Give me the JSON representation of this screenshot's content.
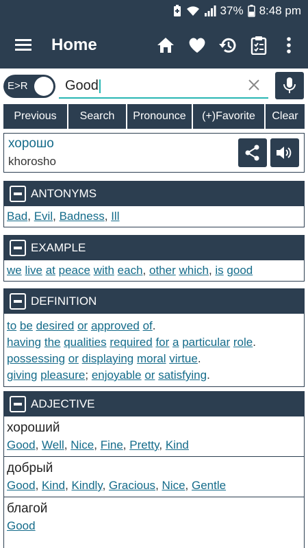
{
  "status": {
    "battery_pct": "37%",
    "time": "8:48 pm"
  },
  "appbar": {
    "title": "Home",
    "actions": [
      "home-icon",
      "heart-icon",
      "history-icon",
      "clipboard-icon",
      "more-icon"
    ]
  },
  "search": {
    "toggle_label": "E>R",
    "value": "Good"
  },
  "buttons": {
    "previous": "Previous",
    "search": "Search",
    "pronounce": "Pronounce",
    "favorite": "(+)Favorite",
    "clear": "Clear"
  },
  "result": {
    "word": "хорошо",
    "transliteration": "khorosho"
  },
  "antonyms": {
    "title": "ANTONYMS",
    "words": [
      "Bad",
      "Evil",
      "Badness",
      "Ill"
    ]
  },
  "example": {
    "title": "EXAMPLE",
    "words": [
      "we",
      "live",
      "at",
      "peace",
      "with",
      "each",
      "other",
      "which",
      "is",
      "good"
    ]
  },
  "definition": {
    "title": "DEFINITION",
    "lines": [
      [
        "to",
        "be",
        "desired",
        "or",
        "approved",
        "of"
      ],
      [
        "having",
        "the",
        "qualities",
        "required",
        "for",
        "a",
        "particular",
        "role"
      ],
      [
        "possessing",
        "or",
        "displaying",
        "moral",
        "virtue"
      ],
      [
        "giving",
        "pleasure",
        "enjoyable",
        "or",
        "satisfying"
      ]
    ]
  },
  "adjective": {
    "title": "ADJECTIVE",
    "entries": [
      {
        "word": "хороший",
        "translations": [
          "Good",
          "Well",
          "Nice",
          "Fine",
          "Pretty",
          "Kind"
        ]
      },
      {
        "word": "добрый",
        "translations": [
          "Good",
          "Kind",
          "Kindly",
          "Gracious",
          "Nice",
          "Gentle"
        ]
      },
      {
        "word": "благой",
        "translations": [
          "Good"
        ]
      }
    ]
  },
  "colors": {
    "primary": "#2c3e50",
    "accent": "#27b6b3",
    "link": "#146b8a"
  }
}
